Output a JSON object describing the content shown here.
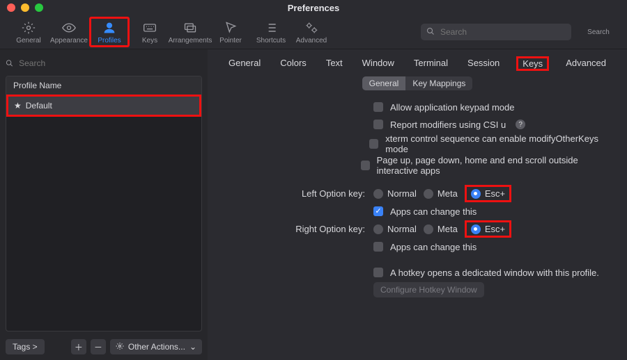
{
  "window": {
    "title": "Preferences"
  },
  "toolbar": {
    "items": [
      {
        "label": "General",
        "icon": "gear"
      },
      {
        "label": "Appearance",
        "icon": "eye"
      },
      {
        "label": "Profiles",
        "icon": "person"
      },
      {
        "label": "Keys",
        "icon": "keyboard"
      },
      {
        "label": "Arrangements",
        "icon": "windows"
      },
      {
        "label": "Pointer",
        "icon": "pointer"
      },
      {
        "label": "Shortcuts",
        "icon": "list"
      },
      {
        "label": "Advanced",
        "icon": "gears"
      }
    ],
    "selected": "Profiles",
    "search_placeholder": "Search",
    "search_label": "Search"
  },
  "sidebar": {
    "search_placeholder": "Search",
    "header": "Profile Name",
    "items": [
      {
        "name": "Default",
        "starred": true,
        "selected": true
      }
    ],
    "footer": {
      "tags_label": "Tags >",
      "other_actions_label": "Other Actions..."
    }
  },
  "main": {
    "tabs": [
      "General",
      "Colors",
      "Text",
      "Window",
      "Terminal",
      "Session",
      "Keys",
      "Advanced"
    ],
    "tab_selected": "Keys",
    "subtabs": [
      "General",
      "Key Mappings"
    ],
    "subtab_selected": "General",
    "checkboxes": {
      "allow_keypad": "Allow application keypad mode",
      "report_csi": "Report modifiers using CSI u",
      "xterm_other": "xterm control sequence can enable modifyOtherKeys mode",
      "page_scroll": "Page up, page down, home and end scroll outside interactive apps",
      "apps_change_left": "Apps can change this",
      "apps_change_right": "Apps can change this",
      "hotkey_profile": "A hotkey opens a dedicated window with this profile."
    },
    "labels": {
      "left_option": "Left Option key:",
      "right_option": "Right Option key:"
    },
    "radios": {
      "normal": "Normal",
      "meta": "Meta",
      "esc": "Esc+"
    },
    "left_option_selected": "Esc+",
    "right_option_selected": "Esc+",
    "apps_change_left_checked": true,
    "apps_change_right_checked": false,
    "button_configure": "Configure Hotkey Window"
  }
}
